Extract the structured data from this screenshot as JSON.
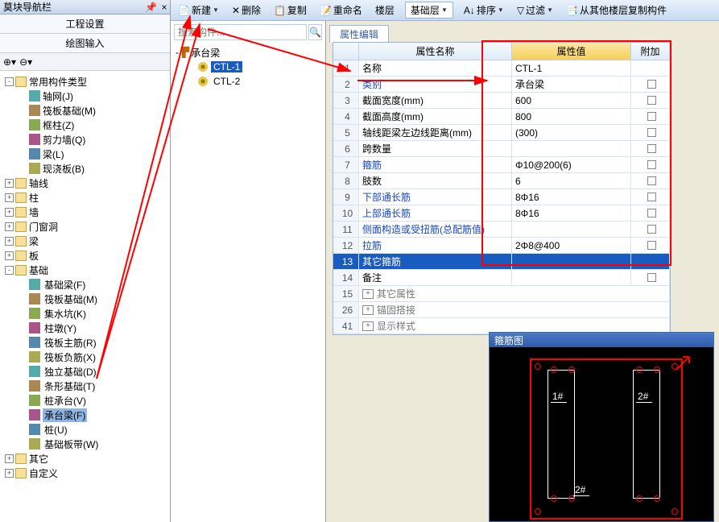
{
  "nav": {
    "title": "莫块导航栏",
    "proj_settings": "工程设置",
    "draw_input": "绘图输入"
  },
  "tree": {
    "common_types": "常用构件类型",
    "items_common": [
      {
        "label": "轴网(J)"
      },
      {
        "label": "筏板基础(M)"
      },
      {
        "label": "框柱(Z)"
      },
      {
        "label": "剪力墙(Q)"
      },
      {
        "label": "梁(L)"
      },
      {
        "label": "现浇板(B)"
      }
    ],
    "cats": [
      {
        "label": "轴线",
        "exp": "+"
      },
      {
        "label": "柱",
        "exp": "+"
      },
      {
        "label": "墙",
        "exp": "+"
      },
      {
        "label": "门窗洞",
        "exp": "+"
      },
      {
        "label": "梁",
        "exp": "+"
      },
      {
        "label": "板",
        "exp": "+"
      }
    ],
    "foundation": "基础",
    "foundation_items": [
      {
        "label": "基础梁(F)"
      },
      {
        "label": "筏板基础(M)"
      },
      {
        "label": "集水坑(K)"
      },
      {
        "label": "柱墩(Y)"
      },
      {
        "label": "筏板主筋(R)"
      },
      {
        "label": "筏板负筋(X)"
      },
      {
        "label": "独立基础(D)"
      },
      {
        "label": "条形基础(T)"
      },
      {
        "label": "桩承台(V)"
      },
      {
        "label": "承台梁(F)",
        "selected": true
      },
      {
        "label": "桩(U)"
      },
      {
        "label": "基础板带(W)"
      }
    ],
    "other": "其它",
    "custom": "自定义"
  },
  "toolbar": {
    "new": "新建",
    "delete": "删除",
    "copy": "复制",
    "rename": "重命名",
    "floor": "楼层",
    "floor_sel": "基础层",
    "sort": "排序",
    "filter": "过滤",
    "copy_from": "从其他楼层复制构件"
  },
  "search": {
    "placeholder": "搜索构件..."
  },
  "mid_tree": {
    "root": "承台梁",
    "items": [
      {
        "label": "CTL-1",
        "selected": true
      },
      {
        "label": "CTL-2"
      }
    ]
  },
  "prop_tab": "属性编辑",
  "prop_head": {
    "name": "属性名称",
    "val": "属性值",
    "ext": "附加"
  },
  "props": [
    {
      "n": "1",
      "name": "名称",
      "val": "CTL-1",
      "link": false,
      "cb": false
    },
    {
      "n": "2",
      "name": "类别",
      "val": "承台梁",
      "link": true,
      "cb": true
    },
    {
      "n": "3",
      "name": "截面宽度(mm)",
      "val": "600",
      "link": false,
      "cb": true
    },
    {
      "n": "4",
      "name": "截面高度(mm)",
      "val": "800",
      "link": false,
      "cb": true
    },
    {
      "n": "5",
      "name": "轴线距梁左边线距离(mm)",
      "val": "(300)",
      "link": false,
      "cb": true
    },
    {
      "n": "6",
      "name": "跨数量",
      "val": "",
      "link": false,
      "cb": true
    },
    {
      "n": "7",
      "name": "箍筋",
      "val": "Φ10@200(6)",
      "link": true,
      "cb": true
    },
    {
      "n": "8",
      "name": "肢数",
      "val": "6",
      "link": false,
      "cb": true
    },
    {
      "n": "9",
      "name": "下部通长筋",
      "val": "8Φ16",
      "link": true,
      "cb": true
    },
    {
      "n": "10",
      "name": "上部通长筋",
      "val": "8Φ16",
      "link": true,
      "cb": true
    },
    {
      "n": "11",
      "name": "侧面构造或受扭筋(总配筋值)",
      "val": "",
      "link": true,
      "cb": true
    },
    {
      "n": "12",
      "name": "拉筋",
      "val": "2Φ8@400",
      "link": true,
      "cb": true
    },
    {
      "n": "13",
      "name": "其它箍筋",
      "val": "",
      "link": false,
      "cb": false,
      "selected": true
    },
    {
      "n": "14",
      "name": "备注",
      "val": "",
      "link": false,
      "cb": true
    }
  ],
  "prop_groups": [
    {
      "n": "15",
      "label": "其它属性"
    },
    {
      "n": "26",
      "label": "锚固搭接"
    },
    {
      "n": "41",
      "label": "显示样式"
    }
  ],
  "diagram": {
    "title": "箍筋图",
    "labels": {
      "tl": "1#",
      "tr": "2#",
      "bl": "2#"
    }
  }
}
